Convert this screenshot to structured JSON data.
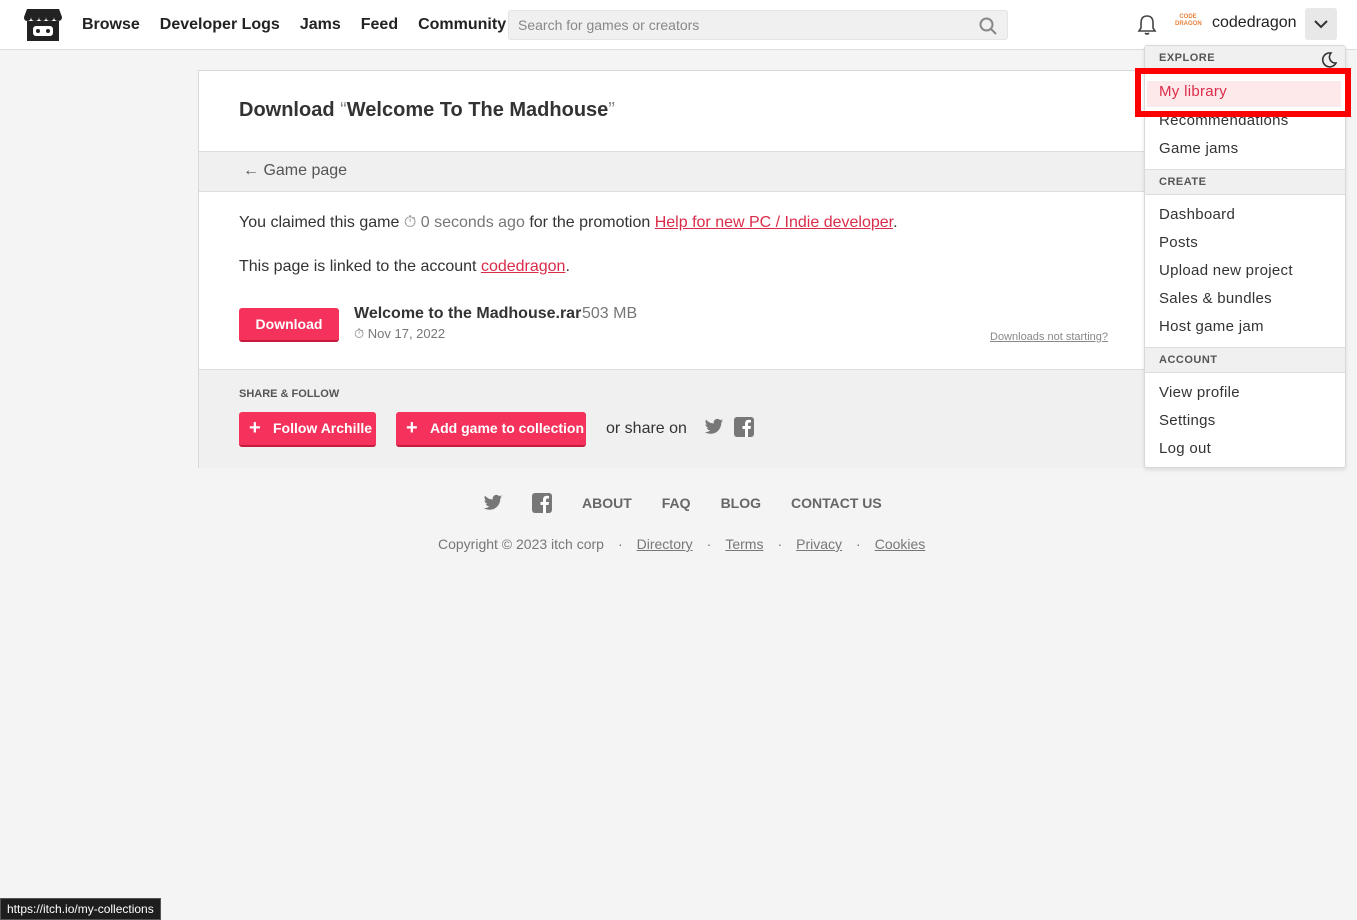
{
  "header": {
    "nav": [
      "Browse",
      "Developer Logs",
      "Jams",
      "Feed",
      "Community"
    ],
    "search_placeholder": "Search for games or creators",
    "username": "codedragon",
    "avatar_text": "CODE DRAGON"
  },
  "page": {
    "title_prefix": "Download",
    "open_quote": "“",
    "game_title": "Welcome To The Madhouse",
    "close_quote": "”",
    "back_link": "← Game page",
    "claim_prefix": "You claimed this game",
    "claim_time": "⏱ 0 seconds ago",
    "claim_mid": "for the promotion",
    "promotion": "Help for new PC / Indie developer",
    "period": ".",
    "linked_prefix": "This page is linked to the account",
    "linked_account": "codedragon",
    "download_label": "Download",
    "file_name": "Welcome to the Madhouse.rar",
    "file_size": "503 MB",
    "file_date": "⏱ Nov 17, 2022",
    "not_starting": "Downloads not starting?",
    "share_label": "SHARE & FOLLOW",
    "follow_label": "Follow Archille",
    "add_collection_label": "Add game to collection",
    "or_share": "or share on"
  },
  "footer": {
    "links": [
      "ABOUT",
      "FAQ",
      "BLOG",
      "CONTACT US"
    ],
    "copyright": "Copyright © 2023 itch corp",
    "dot": "·",
    "legal": [
      "Directory",
      "Terms",
      "Privacy",
      "Cookies"
    ]
  },
  "dropdown": {
    "explore_header": "EXPLORE",
    "explore": [
      "My library",
      "Recommendations",
      "Game jams"
    ],
    "create_header": "CREATE",
    "create": [
      "Dashboard",
      "Posts",
      "Upload new project",
      "Sales & bundles",
      "Host game jam"
    ],
    "account_header": "ACCOUNT",
    "account": [
      "View profile",
      "Settings",
      "Log out"
    ]
  },
  "status_url": "https://itch.io/my-collections",
  "colors": {
    "accent": "#f5325c",
    "link": "#da2c49",
    "highlight": "#ff0000"
  }
}
